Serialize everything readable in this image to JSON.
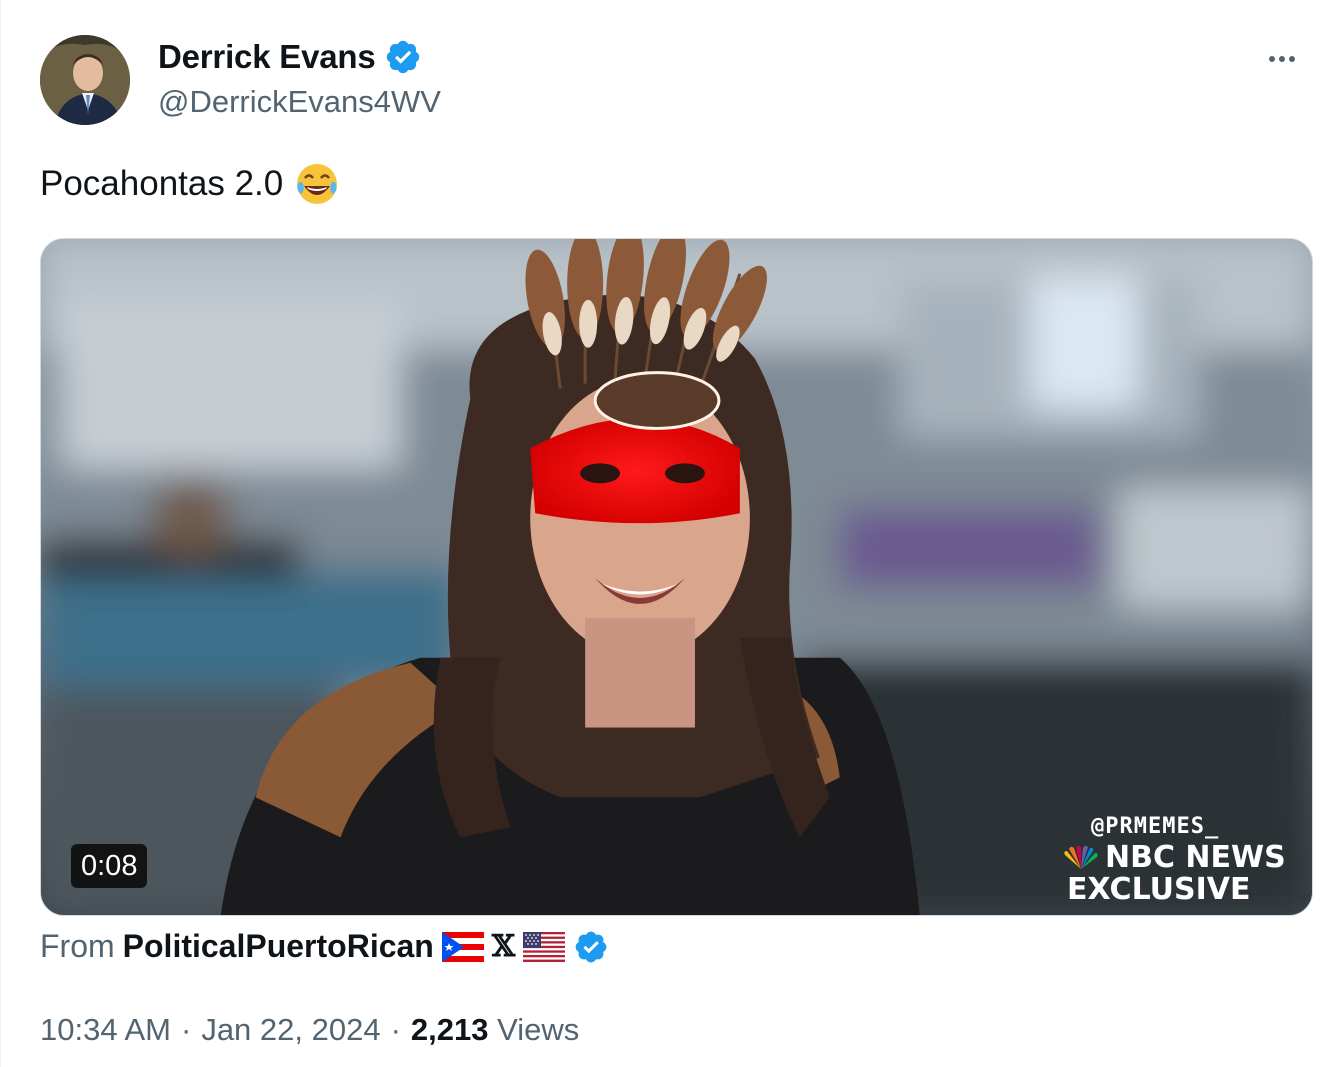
{
  "author": {
    "display_name": "Derrick Evans",
    "handle": "@DerrickEvans4WV",
    "verified_icon": "verified-badge-icon",
    "avatar_icon": "avatar"
  },
  "tweet": {
    "text": "Pocahontas 2.0",
    "emoji_icon": "tears-of-joy-emoji-icon"
  },
  "media": {
    "duration": "0:08",
    "watermark": "@PRMEMES_",
    "network_line1": "NBC NEWS",
    "network_line2": "EXCLUSIVE"
  },
  "source": {
    "label": "From",
    "name": "PoliticalPuertoRican",
    "x_glyph": "𝕏",
    "icons": [
      "puerto-rico-flag-icon",
      "x-logo-icon",
      "us-flag-icon",
      "verified-badge-icon"
    ]
  },
  "meta": {
    "time": "10:34 AM",
    "separator": "·",
    "date": "Jan 22, 2024",
    "views_count": "2,213",
    "views_label": "Views"
  },
  "colors": {
    "text_primary": "#0f1419",
    "text_secondary": "#536471",
    "verified_blue": "#1d9bf0",
    "border": "#cfd9de"
  }
}
